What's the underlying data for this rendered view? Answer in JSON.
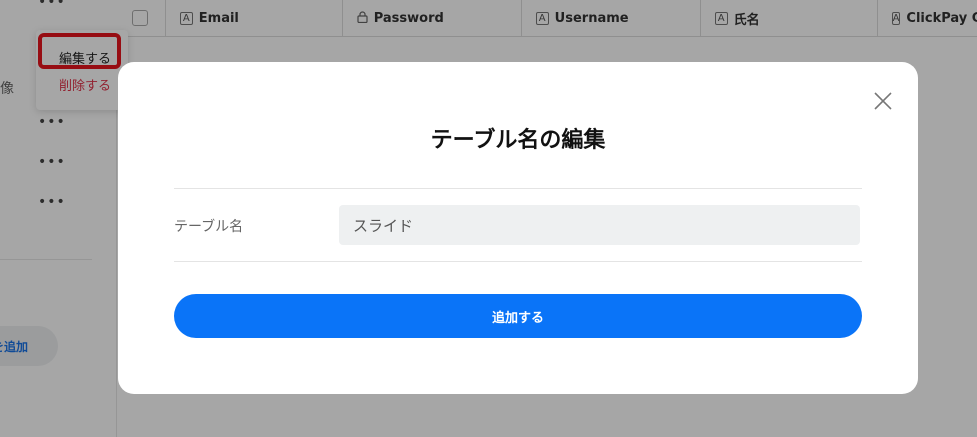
{
  "table": {
    "columns": [
      {
        "icon": "text-type-icon",
        "glyph": "A",
        "label": "Email"
      },
      {
        "icon": "lock-icon",
        "glyph": "🔒",
        "label": "Password"
      },
      {
        "icon": "text-type-icon",
        "glyph": "A",
        "label": "Username"
      },
      {
        "icon": "text-type-icon",
        "glyph": "A",
        "label": "氏名"
      },
      {
        "icon": "text-type-icon",
        "glyph": "A",
        "label": "ClickPay C"
      }
    ]
  },
  "sidebar": {
    "partial_label": "像",
    "add_button_label": "を追加"
  },
  "context_menu": {
    "edit_label": "編集する",
    "delete_label": "削除する"
  },
  "modal": {
    "title": "テーブル名の編集",
    "field_label": "テーブル名",
    "field_value": "スライド",
    "submit_label": "追加する"
  },
  "colors": {
    "accent": "#0a74f8",
    "delete": "#e0344b",
    "highlight": "#e8141e"
  }
}
